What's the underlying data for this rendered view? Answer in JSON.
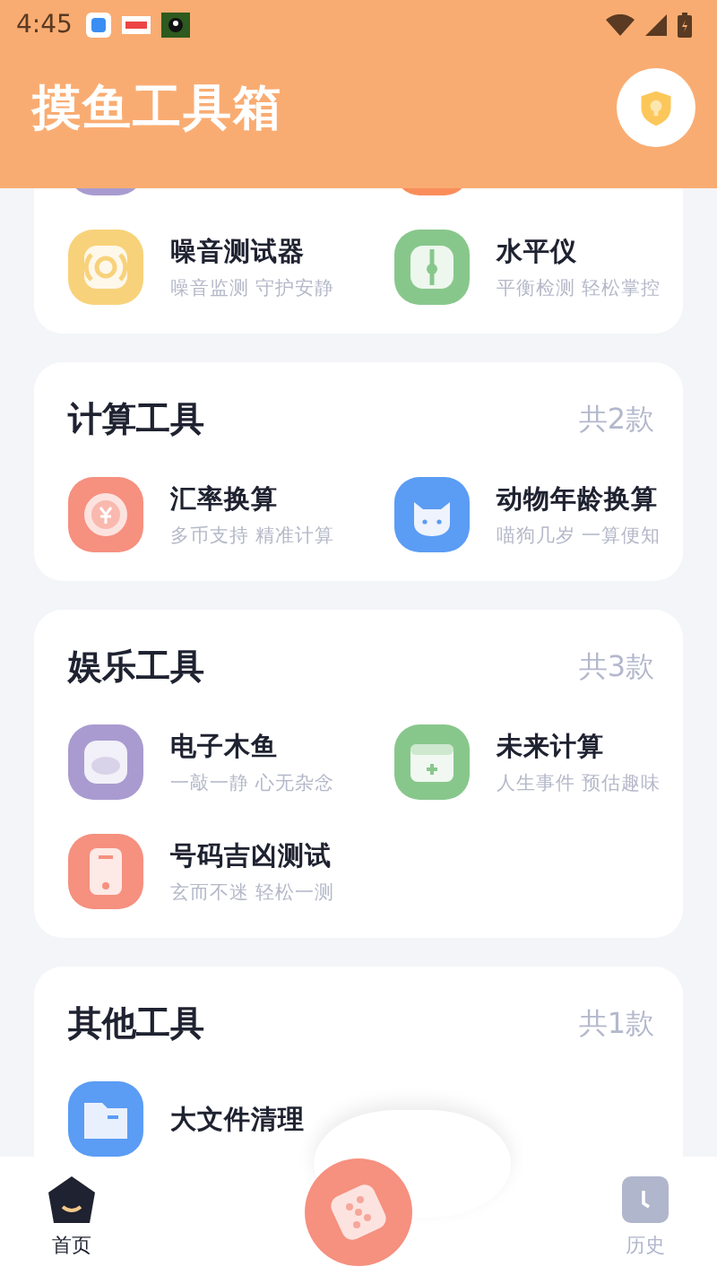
{
  "status_bar": {
    "time": "4:45"
  },
  "header": {
    "title": "摸鱼工具箱"
  },
  "sections": [
    {
      "items": [
        {
          "kind": "blank",
          "color": "#a99bd0"
        },
        {
          "kind": "blank",
          "color": "#f98e5a"
        },
        {
          "kind": "noise",
          "color": "#f8d27a",
          "title": "噪音测试器",
          "subtitle": "噪音监测 守护安静"
        },
        {
          "kind": "level",
          "color": "#88c78c",
          "title": "水平仪",
          "subtitle": "平衡检测 轻松掌控"
        }
      ]
    },
    {
      "title": "计算工具",
      "count": "共2款",
      "items": [
        {
          "kind": "coin",
          "color": "#f6907f",
          "title": "汇率换算",
          "subtitle": "多币支持 精准计算"
        },
        {
          "kind": "cat",
          "color": "#5b9cf4",
          "title": "动物年龄换算",
          "subtitle": "喵狗几岁 一算便知"
        }
      ]
    },
    {
      "title": "娱乐工具",
      "count": "共3款",
      "items": [
        {
          "kind": "fish",
          "color": "#a99bd0",
          "title": "电子木鱼",
          "subtitle": "一敲一静 心无杂念"
        },
        {
          "kind": "calendar",
          "color": "#88c78c",
          "title": "未来计算",
          "subtitle": "人生事件 预估趣味"
        },
        {
          "kind": "phone",
          "color": "#f6907f",
          "title": "号码吉凶测试",
          "subtitle": "玄而不迷 轻松一测"
        }
      ]
    },
    {
      "title": "其他工具",
      "count": "共1款",
      "items": [
        {
          "kind": "folder",
          "color": "#5b9cf4",
          "title": "大文件清理"
        }
      ]
    }
  ],
  "nav": [
    {
      "label": "首页",
      "kind": "home",
      "selected": true
    },
    {
      "kind": "dice"
    },
    {
      "label": "历史",
      "kind": "history",
      "selected": false
    }
  ]
}
